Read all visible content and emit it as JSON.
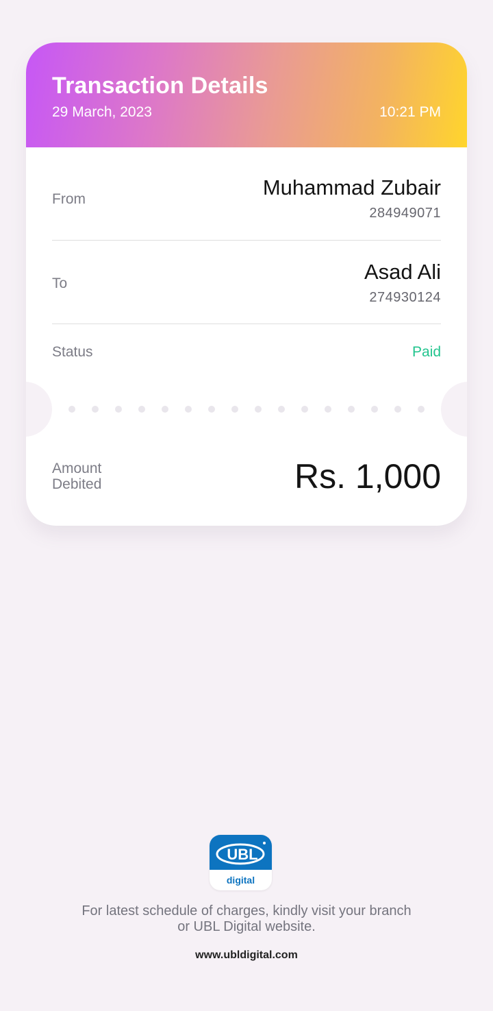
{
  "header": {
    "title": "Transaction Details",
    "date": "29 March, 2023",
    "time": "10:21 PM"
  },
  "from": {
    "label": "From",
    "name": "Muhammad Zubair",
    "account": "284949071"
  },
  "to": {
    "label": "To",
    "name": "Asad Ali",
    "account": "274930124"
  },
  "status": {
    "label": "Status",
    "value": "Paid",
    "color": "#22c48e"
  },
  "amount": {
    "label_line1": "Amount",
    "label_line2": "Debited",
    "value": "Rs. 1,000"
  },
  "footer": {
    "logo_text": "UBL",
    "logo_subtext": "digital",
    "note_line1": "For latest schedule of charges, kindly visit your branch",
    "note_line2": "or UBL Digital website.",
    "url": "www.ubldigital.com"
  },
  "colors": {
    "brand_blue": "#0d74c0",
    "gradient_start": "#c657f6",
    "gradient_end": "#ffd52c"
  }
}
